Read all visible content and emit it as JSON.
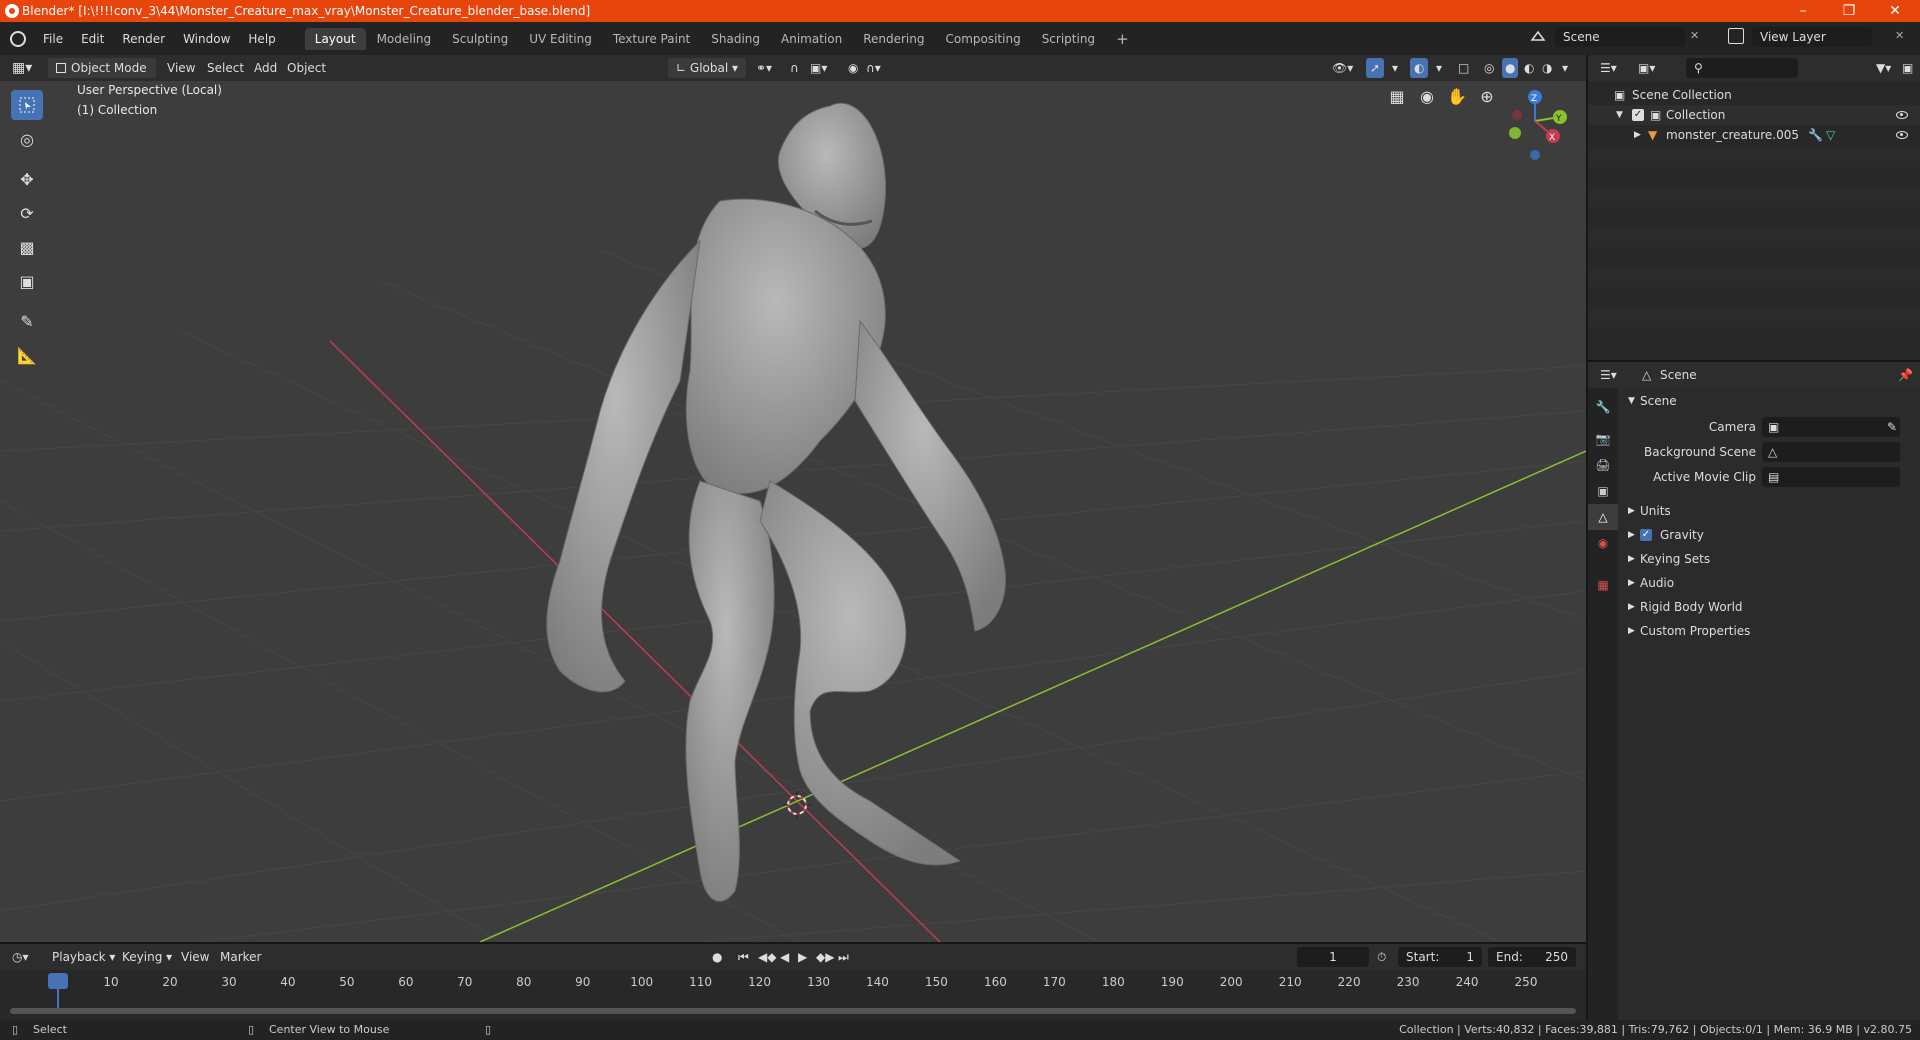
{
  "window": {
    "title": "Blender* [I:\\!!!!conv_3\\44\\Monster_Creature_max_vray\\Monster_Creature_blender_base.blend]"
  },
  "menubar": {
    "menus": [
      "File",
      "Edit",
      "Render",
      "Window",
      "Help"
    ],
    "workspaces": [
      "Layout",
      "Modeling",
      "Sculpting",
      "UV Editing",
      "Texture Paint",
      "Shading",
      "Animation",
      "Rendering",
      "Compositing",
      "Scripting"
    ],
    "active_workspace": "Layout",
    "add_tab": "+",
    "scene_value": "Scene",
    "view_layer_value": "View Layer"
  },
  "viewport_header": {
    "mode": "Object Mode",
    "menus": [
      "View",
      "Select",
      "Add",
      "Object"
    ],
    "orientation": "Global"
  },
  "viewport": {
    "overlay_line1": "User Perspective (Local)",
    "overlay_line2": "(1) Collection",
    "gizmo": {
      "z": "Z",
      "y": "Y",
      "x": "X"
    }
  },
  "outliner": {
    "rows": [
      {
        "label": "Scene Collection"
      },
      {
        "label": "Collection"
      },
      {
        "label": "monster_creature.005"
      }
    ]
  },
  "properties": {
    "header": "Scene",
    "panel_title": "Scene",
    "fields": [
      {
        "label": "Camera"
      },
      {
        "label": "Background Scene"
      },
      {
        "label": "Active Movie Clip"
      }
    ],
    "sections": [
      "Units",
      "Gravity",
      "Keying Sets",
      "Audio",
      "Rigid Body World",
      "Custom Properties"
    ]
  },
  "timeline": {
    "menus": [
      "Playback",
      "Keying",
      "View",
      "Marker"
    ],
    "current_frame": "1",
    "start_label": "Start:",
    "start_value": "1",
    "end_label": "End:",
    "end_value": "250",
    "ticks": [
      "1",
      "10",
      "20",
      "30",
      "40",
      "50",
      "60",
      "70",
      "80",
      "90",
      "100",
      "110",
      "120",
      "130",
      "140",
      "150",
      "160",
      "170",
      "180",
      "190",
      "200",
      "210",
      "220",
      "230",
      "240",
      "250"
    ]
  },
  "statusbar": {
    "left": "Select",
    "middle": "Center View to Mouse",
    "right": "Collection | Verts:40,832 | Faces:39,881 | Tris:79,762 | Objects:0/1 | Mem: 36.9 MB | v2.80.75"
  },
  "colors": {
    "title_bar": "#e8450c",
    "accent": "#4772b3",
    "x_axis": "#c33d4d",
    "y_axis": "#8ac12d",
    "z_axis": "#3b7ad8"
  }
}
